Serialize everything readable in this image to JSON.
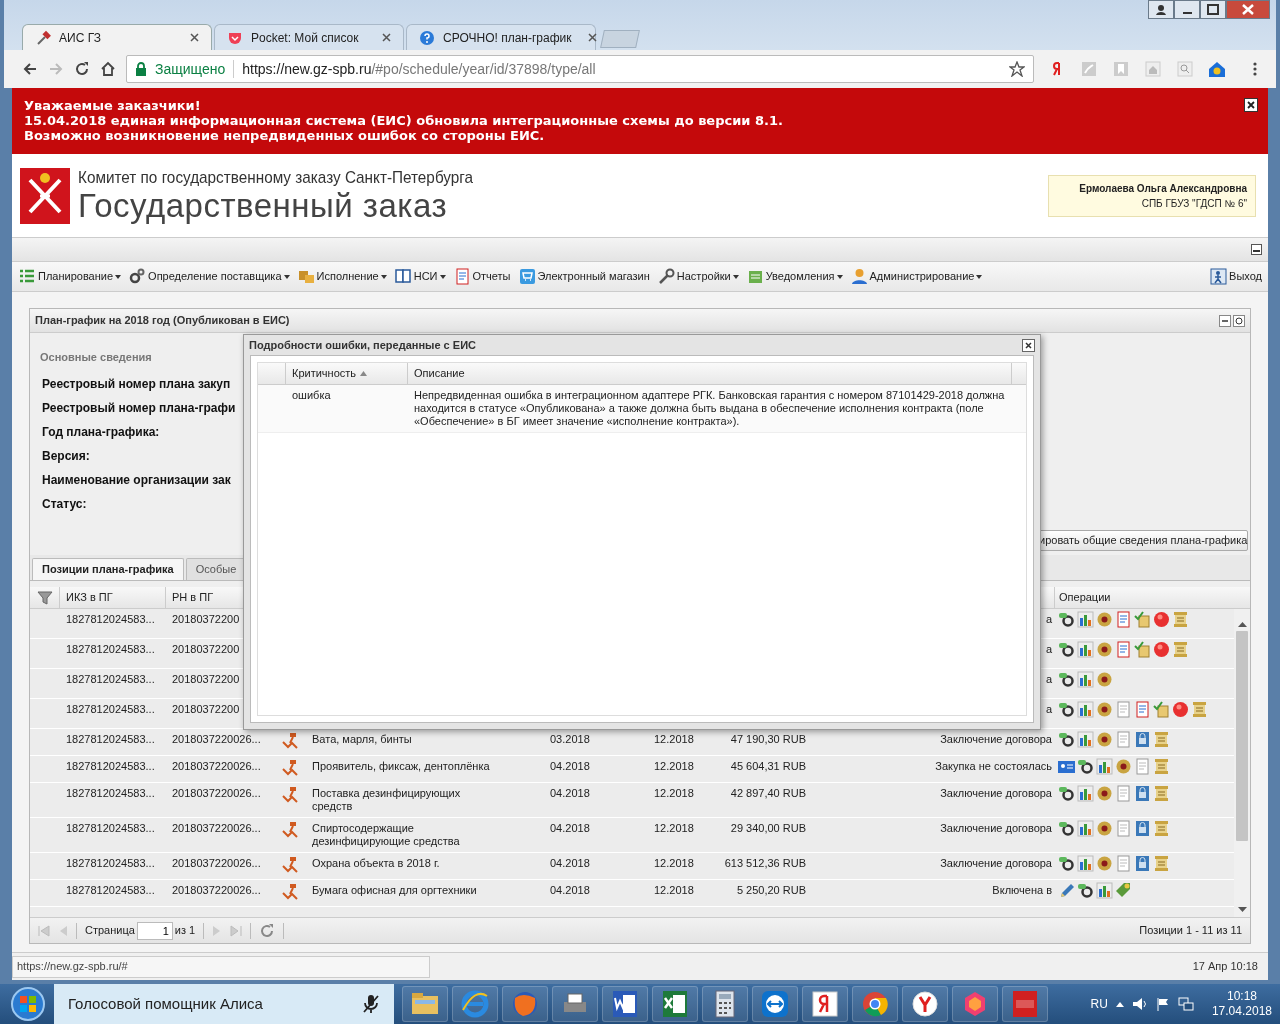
{
  "browser": {
    "tabs": [
      {
        "title": "АИС ГЗ",
        "selected": true,
        "kind": "hammer"
      },
      {
        "title": "Pocket: Мой список",
        "selected": false,
        "kind": "pocket"
      },
      {
        "title": "СРОЧНО! план-график",
        "selected": false,
        "kind": "help"
      }
    ],
    "security": "Защищено",
    "url_host": "https://new.gz-spb.ru",
    "url_path": "/#po/schedule/year/id/37898/type/all"
  },
  "banner": {
    "lines": [
      "Уважаемые заказчики!",
      "15.04.2018 единая информационная система (ЕИС) обновила интеграционные схемы до версии 8.1.",
      "Возможно возникновение непредвиденных ошибок со стороны ЕИС."
    ]
  },
  "header": {
    "org": "Комитет по государственному заказу Санкт-Петербурга",
    "title": "Государственный заказ",
    "user_name": "Ермолаева Ольга Александровна",
    "user_org": "СПБ ГБУЗ \"ГДСП № 6\""
  },
  "menu": [
    {
      "label": "Планирование",
      "kind": "list",
      "dropdown": true
    },
    {
      "label": "Определение поставщика",
      "kind": "gears",
      "dropdown": true
    },
    {
      "label": "Исполнение",
      "kind": "boxes",
      "dropdown": true
    },
    {
      "label": "НСИ",
      "kind": "book",
      "dropdown": true
    },
    {
      "label": "Отчеты",
      "kind": "report",
      "dropdown": false
    },
    {
      "label": "Электронный магазин",
      "kind": "cart",
      "dropdown": false
    },
    {
      "label": "Настройки",
      "kind": "wrench",
      "dropdown": true
    },
    {
      "label": "Уведомления",
      "kind": "note",
      "dropdown": true
    },
    {
      "label": "Администрирование",
      "kind": "user",
      "dropdown": true
    }
  ],
  "logout": "Выход",
  "panel": {
    "title": "План-график на 2018 год (Опубликован в ЕИС)",
    "section": "Основные сведения",
    "fields": [
      "Реестровый номер плана закуп",
      "Реестровый номер плана-графи",
      "Год плана-графика:",
      "Версия:",
      "Наименование организации зак",
      "Статус:"
    ],
    "action_button": "ировать общие сведения плана-графика",
    "tabs": [
      {
        "label": "Позиции плана-графика",
        "selected": true
      },
      {
        "label": "Особые",
        "selected": false
      }
    ],
    "columns": [
      "ИКЗ в ПГ",
      "РН в ПГ",
      "Операции"
    ],
    "rows": [
      {
        "ikz": "1827812024583...",
        "rn": "20180372200",
        "status": "а",
        "ops": [
          {
            "kind": "gear"
          },
          {
            "kind": "chart"
          },
          {
            "kind": "emblem"
          },
          {
            "kind": "report"
          },
          {
            "kind": "sign"
          },
          {
            "kind": "stop"
          },
          {
            "kind": "scroll"
          }
        ]
      },
      {
        "ikz": "1827812024583...",
        "rn": "20180372200",
        "status": "а",
        "ops": [
          {
            "kind": "gear"
          },
          {
            "kind": "chart"
          },
          {
            "kind": "emblem"
          },
          {
            "kind": "report"
          },
          {
            "kind": "sign"
          },
          {
            "kind": "stop"
          },
          {
            "kind": "scroll"
          }
        ]
      },
      {
        "ikz": "1827812024583...",
        "rn": "20180372200",
        "status": "а",
        "ops": [
          {
            "kind": "gear"
          },
          {
            "kind": "chart"
          },
          {
            "kind": "emblem"
          }
        ]
      },
      {
        "ikz": "1827812024583...",
        "rn": "20180372200",
        "status": "а",
        "ops": [
          {
            "kind": "gear"
          },
          {
            "kind": "chart"
          },
          {
            "kind": "emblem"
          },
          {
            "kind": "doc"
          },
          {
            "kind": "report"
          },
          {
            "kind": "sign"
          },
          {
            "kind": "stop"
          },
          {
            "kind": "scroll"
          }
        ]
      },
      {
        "ikz": "1827812024583...",
        "rn": "2018037220026...",
        "name": "Вата, марля, бинты",
        "start": "03.2018",
        "end": "12.2018",
        "amount": "47 190,30 RUB",
        "status": "Заключение договора",
        "ops": [
          {
            "kind": "gear"
          },
          {
            "kind": "chart"
          },
          {
            "kind": "emblem"
          },
          {
            "kind": "doc"
          },
          {
            "kind": "book"
          },
          {
            "kind": "scroll"
          }
        ]
      },
      {
        "ikz": "1827812024583...",
        "rn": "2018037220026...",
        "name": "Проявитель, фиксаж, дентоплёнка",
        "start": "04.2018",
        "end": "12.2018",
        "amount": "45 604,31 RUB",
        "status": "Закупка не состоялась",
        "ops": [
          {
            "kind": "card"
          },
          {
            "kind": "gear"
          },
          {
            "kind": "chart"
          },
          {
            "kind": "emblem"
          },
          {
            "kind": "doc"
          },
          {
            "kind": "scroll"
          }
        ]
      },
      {
        "ikz": "1827812024583...",
        "rn": "2018037220026...",
        "name": "Поставка дезинфицирующих средств",
        "start": "04.2018",
        "end": "12.2018",
        "amount": "42 897,40 RUB",
        "status": "Заключение договора",
        "ops": [
          {
            "kind": "gear"
          },
          {
            "kind": "chart"
          },
          {
            "kind": "emblem"
          },
          {
            "kind": "doc"
          },
          {
            "kind": "book"
          },
          {
            "kind": "scroll"
          }
        ]
      },
      {
        "ikz": "1827812024583...",
        "rn": "2018037220026...",
        "name": "Спиртосодержащие дезинфицирующие средства",
        "start": "04.2018",
        "end": "12.2018",
        "amount": "29 340,00 RUB",
        "status": "Заключение договора",
        "ops": [
          {
            "kind": "gear"
          },
          {
            "kind": "chart"
          },
          {
            "kind": "emblem"
          },
          {
            "kind": "doc"
          },
          {
            "kind": "book"
          },
          {
            "kind": "scroll"
          }
        ]
      },
      {
        "ikz": "1827812024583...",
        "rn": "2018037220026...",
        "name": "Охрана объекта в 2018 г.",
        "start": "04.2018",
        "end": "12.2018",
        "amount": "613 512,36 RUB",
        "status": "Заключение договора",
        "ops": [
          {
            "kind": "gear"
          },
          {
            "kind": "chart"
          },
          {
            "kind": "emblem"
          },
          {
            "kind": "doc"
          },
          {
            "kind": "book"
          },
          {
            "kind": "scroll"
          }
        ]
      },
      {
        "ikz": "1827812024583...",
        "rn": "2018037220026...",
        "name": "Бумага офисная для оргтехники",
        "start": "04.2018",
        "end": "12.2018",
        "amount": "5 250,20 RUB",
        "status": "Включена в",
        "ops": [
          {
            "kind": "pencil"
          },
          {
            "kind": "gear"
          },
          {
            "kind": "chart"
          },
          {
            "kind": "tag"
          }
        ]
      }
    ],
    "pager": {
      "page_label": "Страница",
      "page": "1",
      "of": "из 1",
      "summary": "Позиции 1 - 11 из 11"
    }
  },
  "dialog": {
    "title": "Подробности ошибки, переданные с ЕИС",
    "columns": [
      {
        "label": "Критичность",
        "sorted": true
      },
      {
        "label": "Описание",
        "sorted": false
      }
    ],
    "rows": [
      {
        "level": "ошибка",
        "description": "Непредвиденная ошибка в интеграционном адаптере РГК. Банковская гарантия с номером 87101429-2018 должна находится в статусе «Опубликована» а также должна быть выдана в обеспечение исполнения контракта (поле «Обеспечение» в БГ имеет значение «исполнение контракта»)."
      }
    ]
  },
  "status_url": "https://new.gz-spb.ru/#",
  "status_time": "17 Апр 10:18",
  "taskbar": {
    "search": "Голосовой помощник Алиса",
    "apps": [
      {
        "kind": "folder"
      },
      {
        "kind": "ie"
      },
      {
        "kind": "firefox"
      },
      {
        "kind": "fax"
      },
      {
        "kind": "word"
      },
      {
        "kind": "excel"
      },
      {
        "kind": "calc"
      },
      {
        "kind": "teamviewer"
      },
      {
        "kind": "yandex"
      },
      {
        "kind": "chrome"
      },
      {
        "kind": "yabrowser"
      },
      {
        "kind": "hexagon"
      },
      {
        "kind": "pdf"
      }
    ],
    "lang": "RU",
    "time": "10:18",
    "date": "17.04.2018"
  }
}
